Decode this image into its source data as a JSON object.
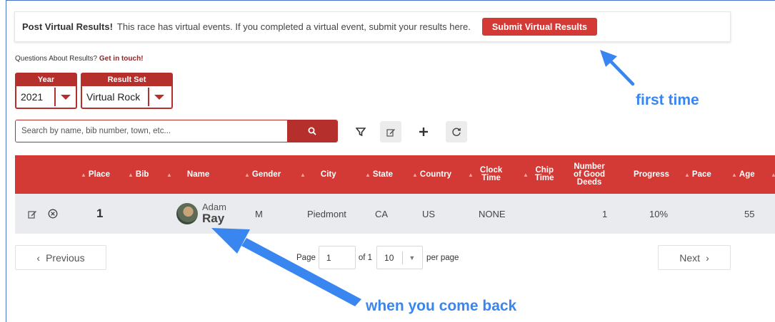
{
  "banner": {
    "title": "Post Virtual Results!",
    "description": "This race has virtual events. If you completed a virtual event, submit your results here.",
    "button_label": "Submit Virtual Results"
  },
  "questions": {
    "text": "Questions About Results?",
    "link": "Get in touch!"
  },
  "year_select": {
    "header": "Year",
    "value": "2021"
  },
  "result_set_select": {
    "header": "Result Set",
    "value": "Virtual Rock"
  },
  "search": {
    "placeholder": "Search by name, bib number, town, etc..."
  },
  "tools": [
    "filter-icon",
    "edit-icon",
    "plus-icon",
    "refresh-icon"
  ],
  "table": {
    "columns": {
      "place": "Place",
      "bib": "Bib",
      "name": "Name",
      "gender": "Gender",
      "city": "City",
      "state": "State",
      "country": "Country",
      "clock_time_1": "Clock",
      "clock_time_2": "Time",
      "chip_time_1": "Chip",
      "chip_time_2": "Time",
      "good_deeds_1": "Number",
      "good_deeds_2": "of Good",
      "good_deeds_3": "Deeds",
      "progress": "Progress",
      "pace": "Pace",
      "age": "Age"
    },
    "row": {
      "place": "1",
      "first_name": "Adam",
      "last_name": "Ray",
      "gender": "M",
      "city": "Piedmont",
      "state": "CA",
      "country": "US",
      "clock_time": "NONE",
      "good_deeds": "1",
      "progress": "10%",
      "age": "55"
    }
  },
  "pagination": {
    "previous": "Previous",
    "next": "Next",
    "page_label": "Page",
    "page_value": "1",
    "of_label": "of 1",
    "per_page_value": "10",
    "per_page_label": "per page"
  },
  "annotations": {
    "first_time": "first time",
    "come_back": "when you come back"
  },
  "colors": {
    "accent": "#d33a35",
    "dark_accent": "#b52f2c",
    "arrow": "#3a86f0"
  }
}
